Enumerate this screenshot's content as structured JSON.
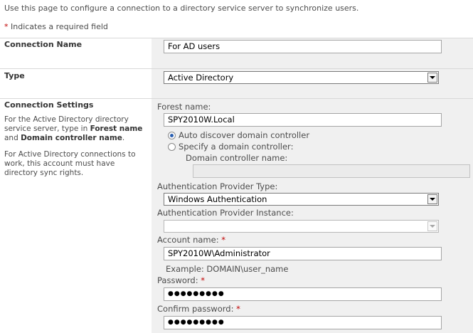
{
  "intro": "Use this page to configure a connection to a directory service server to synchronize users.",
  "required_note": {
    "star": "*",
    "text": " Indicates a required field"
  },
  "connection_name": {
    "label": "Connection Name",
    "value": "For AD users"
  },
  "type": {
    "label": "Type",
    "value": "Active Directory"
  },
  "settings": {
    "label": "Connection Settings",
    "desc1_a": "For the Active Directory directory service server, type in ",
    "desc1_b": "Forest name",
    "desc1_c": " and ",
    "desc1_d": "Domain controller name",
    "desc1_e": ".",
    "desc2": "For Active Directory connections to work, this account must have directory sync rights."
  },
  "forest": {
    "label": "Forest name:",
    "value": "SPY2010W.Local"
  },
  "radio_auto": {
    "label": "Auto discover domain controller",
    "checked": true
  },
  "radio_specify": {
    "label": "Specify a domain controller:",
    "checked": false
  },
  "dc_name": {
    "label": "Domain controller name:",
    "value": ""
  },
  "auth_type": {
    "label": "Authentication Provider Type:",
    "value": "Windows Authentication"
  },
  "auth_instance": {
    "label": "Authentication Provider Instance:",
    "value": ""
  },
  "account": {
    "label": "Account name: ",
    "star": "*",
    "value": "SPY2010W\\Administrator",
    "example": "Example: DOMAIN\\user_name"
  },
  "password": {
    "label": "Password: ",
    "star": "*",
    "value": "●●●●●●●●●"
  },
  "confirm_password": {
    "label": "Confirm password: ",
    "star": "*",
    "value": "●●●●●●●●●"
  }
}
